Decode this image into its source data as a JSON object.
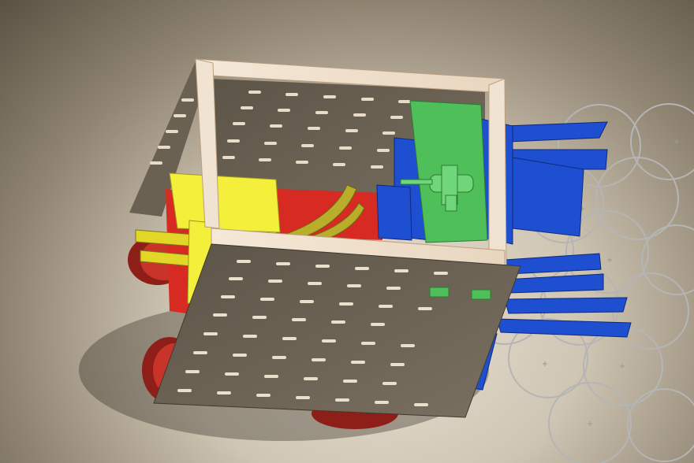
{
  "viewport": {
    "background_top": "#5a5143",
    "background_bottom": "#e9e1d3"
  },
  "model": {
    "parts": [
      {
        "name": "top-frame",
        "color": "#f1e3d1"
      },
      {
        "name": "base-plate",
        "color": "#6f6657"
      },
      {
        "name": "yellow-block",
        "color": "#f3ef3a"
      },
      {
        "name": "red-panel",
        "color": "#d62a22"
      },
      {
        "name": "green-motor-board",
        "color": "#4fbf5a"
      },
      {
        "name": "blue-bracket",
        "color": "#1f4fd1"
      },
      {
        "name": "olive-arc-rail",
        "color": "#b8ae2a"
      },
      {
        "name": "red-wheel",
        "color": "#a3261e"
      }
    ]
  },
  "sketch_overlay": {
    "color": "#b5b5b5"
  }
}
